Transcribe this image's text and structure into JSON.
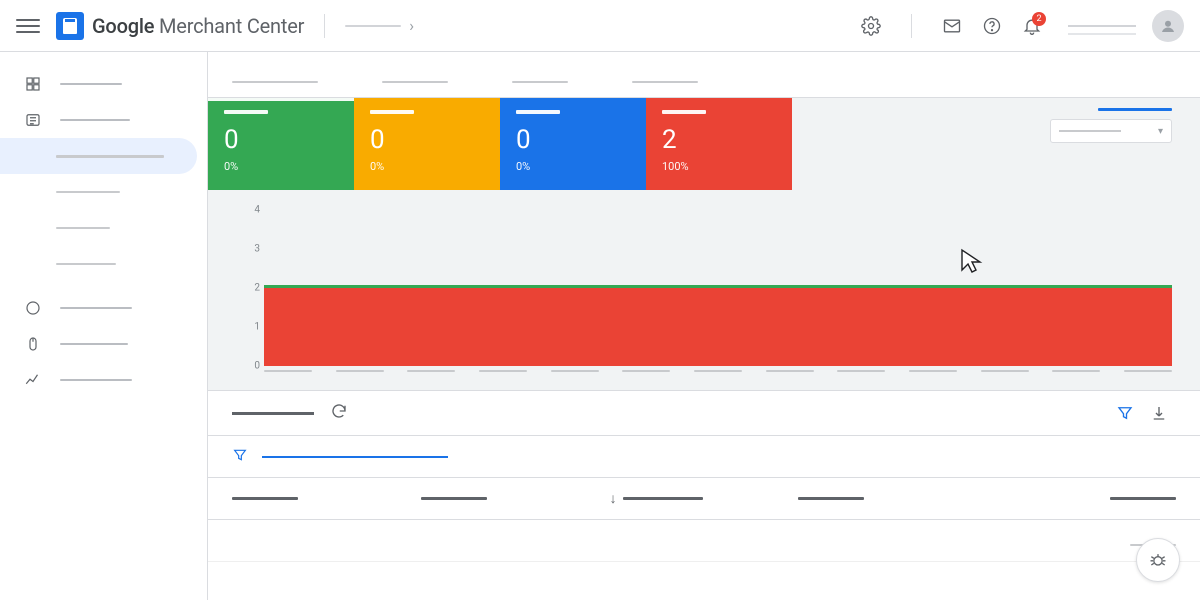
{
  "header": {
    "product_logo_word": "Google",
    "product_name": " Merchant Center",
    "notification_count": "2"
  },
  "tiles": [
    {
      "color": "green",
      "value": "0",
      "pct": "0%",
      "active": true
    },
    {
      "color": "yellow",
      "value": "0",
      "pct": "0%",
      "active": false
    },
    {
      "color": "blue",
      "value": "0",
      "pct": "0%",
      "active": false
    },
    {
      "color": "red",
      "value": "2",
      "pct": "100%",
      "active": false
    }
  ],
  "chart_data": {
    "type": "bar",
    "y_ticks": [
      "0",
      "1",
      "2",
      "3",
      "4"
    ],
    "ylim": [
      0,
      4
    ],
    "series": [
      {
        "name": "red",
        "value": 2
      },
      {
        "name": "green",
        "value": 0.08
      }
    ],
    "x_category_count": 13
  }
}
